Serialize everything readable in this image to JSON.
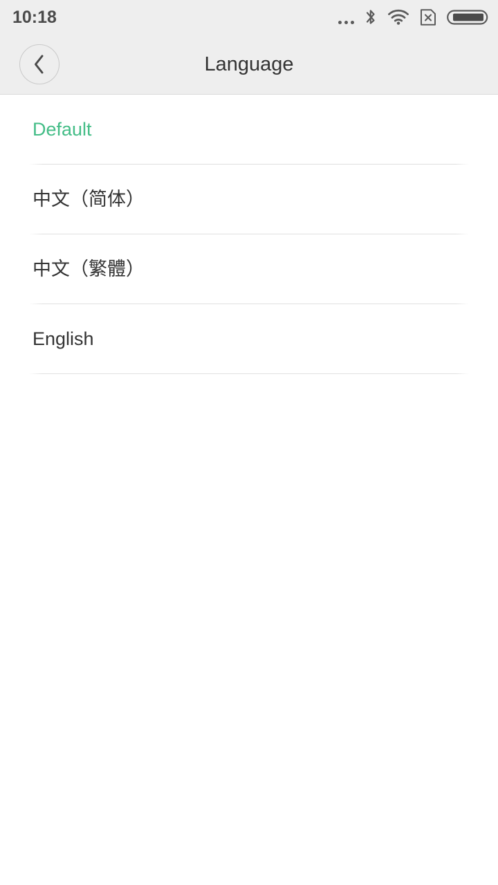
{
  "status_bar": {
    "time": "10:18",
    "icons": [
      {
        "name": "more-dots-icon",
        "label": "more notifications"
      },
      {
        "name": "bluetooth-icon",
        "label": "Bluetooth"
      },
      {
        "name": "wifi-icon",
        "label": "Wi-Fi full signal"
      },
      {
        "name": "no-sim-icon",
        "label": "No SIM card"
      },
      {
        "name": "battery-icon",
        "label": "Battery nearly full"
      }
    ],
    "background_color": "#eeeeee",
    "text_color": "#4a4a4a"
  },
  "header": {
    "title": "Language",
    "back_icon": "chevron-left-icon",
    "background_color": "#eeeeee",
    "title_color": "#333333"
  },
  "colors": {
    "accent_green": "#44bd87",
    "text_primary": "#333333",
    "divider": "#e0e0e0",
    "page_background": "#ffffff"
  },
  "language_list": {
    "items": [
      {
        "label": "Default",
        "selected": true
      },
      {
        "label": "中文（简体）",
        "selected": false
      },
      {
        "label": "中文（繁體）",
        "selected": false
      },
      {
        "label": "English",
        "selected": false
      }
    ]
  }
}
